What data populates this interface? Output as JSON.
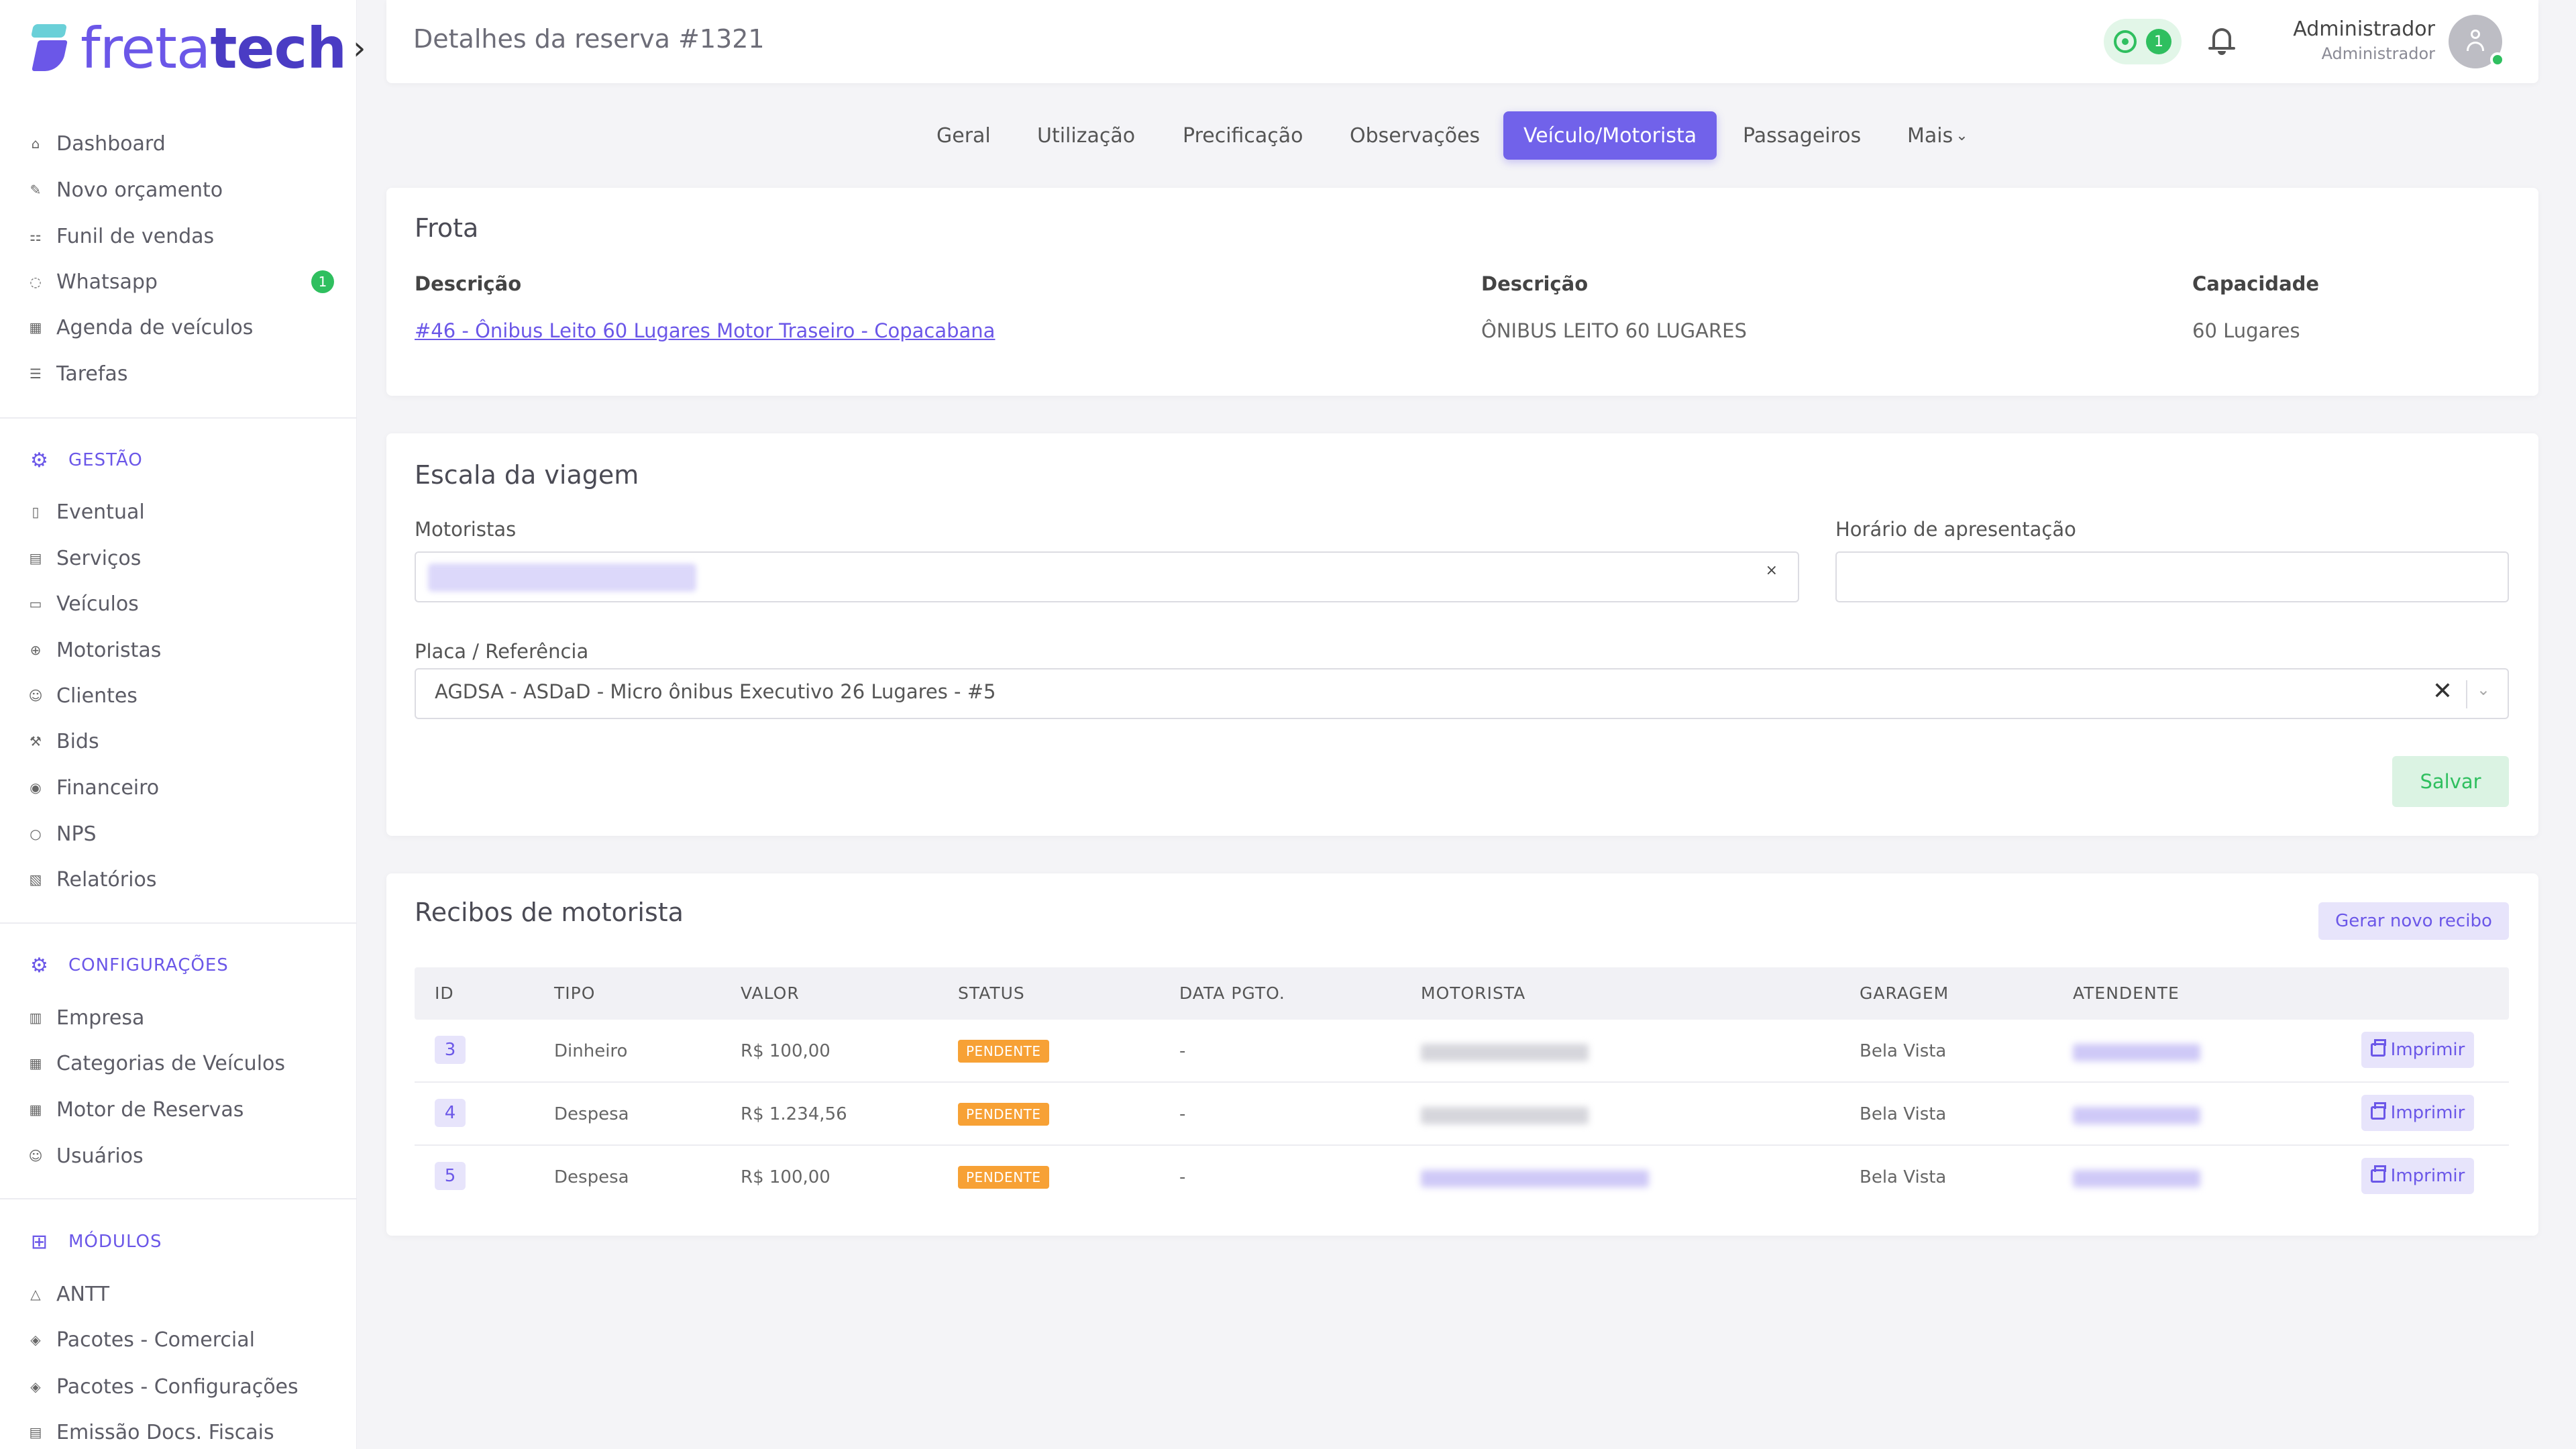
{
  "brand": {
    "name_light": "freta",
    "name_bold": "tech",
    "chevron": "›",
    "mark_color": "#6b57e8",
    "accent_color": "#6ad0d8"
  },
  "sidebar": {
    "main_items": [
      {
        "label": "Dashboard",
        "icon": "home-icon"
      },
      {
        "label": "Novo orçamento",
        "icon": "edit-icon"
      },
      {
        "label": "Funil de vendas",
        "icon": "funnel-icon"
      },
      {
        "label": "Whatsapp",
        "icon": "whatsapp-icon",
        "badge": "1"
      },
      {
        "label": "Agenda de veículos",
        "icon": "calendar-icon"
      },
      {
        "label": "Tarefas",
        "icon": "list-icon"
      }
    ],
    "section_gestao": {
      "title": "GESTÃO",
      "items": [
        {
          "label": "Eventual",
          "icon": "file-icon"
        },
        {
          "label": "Serviços",
          "icon": "document-icon"
        },
        {
          "label": "Veículos",
          "icon": "bus-icon"
        },
        {
          "label": "Motoristas",
          "icon": "steering-wheel-icon"
        },
        {
          "label": "Clientes",
          "icon": "users-icon"
        },
        {
          "label": "Bids",
          "icon": "gavel-icon"
        },
        {
          "label": "Financeiro",
          "icon": "coin-icon"
        },
        {
          "label": "NPS",
          "icon": "chat-icon"
        },
        {
          "label": "Relatórios",
          "icon": "report-icon"
        }
      ]
    },
    "section_config": {
      "title": "CONFIGURAÇÕES",
      "items": [
        {
          "label": "Empresa",
          "icon": "building-icon"
        },
        {
          "label": "Categorias de Veículos",
          "icon": "grid-icon"
        },
        {
          "label": "Motor de Reservas",
          "icon": "table-icon"
        },
        {
          "label": "Usuários",
          "icon": "user-icon"
        }
      ]
    },
    "section_modulos": {
      "title": "MÓDULOS",
      "items": [
        {
          "label": "ANTT",
          "icon": "triangle-icon"
        },
        {
          "label": "Pacotes - Comercial",
          "icon": "package-icon"
        },
        {
          "label": "Pacotes - Configurações",
          "icon": "package-settings-icon"
        },
        {
          "label": "Emissão Docs. Fiscais",
          "icon": "receipt-icon"
        }
      ]
    }
  },
  "header": {
    "title": "Detalhes da reserva #1321",
    "whatsapp_count": "1",
    "user_name": "Administrador",
    "user_role": "Administrador",
    "online_color": "#2fbf5f"
  },
  "tabs": [
    {
      "label": "Geral",
      "active": false
    },
    {
      "label": "Utilização",
      "active": false
    },
    {
      "label": "Precificação",
      "active": false
    },
    {
      "label": "Observações",
      "active": false
    },
    {
      "label": "Veículo/Motorista",
      "active": true
    },
    {
      "label": "Passageiros",
      "active": false
    },
    {
      "label": "Mais",
      "active": false
    }
  ],
  "frota": {
    "title": "Frota",
    "col1_header": "Descrição",
    "col2_header": "Descrição",
    "col3_header": "Capacidade",
    "vehicle_link": "#46 - Ônibus Leito 60 Lugares Motor Traseiro - Copacabana",
    "vehicle_desc": "ÔNIBUS LEITO 60 LUGARES",
    "capacity": "60 Lugares"
  },
  "escala": {
    "title": "Escala da viagem",
    "motoristas_label": "Motoristas",
    "chip_close": "×",
    "horario_label": "Horário de apresentação",
    "horario_value": "",
    "placa_label": "Placa / Referência",
    "placa_value": "AGDSA - ASDaD - Micro ônibus Executivo 26 Lugares - #5",
    "clear_glyph": "✕",
    "save_label": "Salvar"
  },
  "recibos": {
    "title": "Recibos de motorista",
    "generate_label": "Gerar novo recibo",
    "columns": [
      "ID",
      "TIPO",
      "VALOR",
      "STATUS",
      "DATA PGTO.",
      "MOTORISTA",
      "GARAGEM",
      "ATENDENTE"
    ],
    "print_label": "Imprimir",
    "rows": [
      {
        "id": "3",
        "tipo": "Dinheiro",
        "valor": "R$ 100,00",
        "status": "PENDENTE",
        "data_pgto": "-",
        "garagem": "Bela Vista"
      },
      {
        "id": "4",
        "tipo": "Despesa",
        "valor": "R$ 1.234,56",
        "status": "PENDENTE",
        "data_pgto": "-",
        "garagem": "Bela Vista"
      },
      {
        "id": "5",
        "tipo": "Despesa",
        "valor": "R$ 100,00",
        "status": "PENDENTE",
        "data_pgto": "-",
        "garagem": "Bela Vista"
      }
    ]
  },
  "colors": {
    "primary": "#7162ea",
    "success": "#2fbf5f",
    "warning": "#f7a135"
  }
}
